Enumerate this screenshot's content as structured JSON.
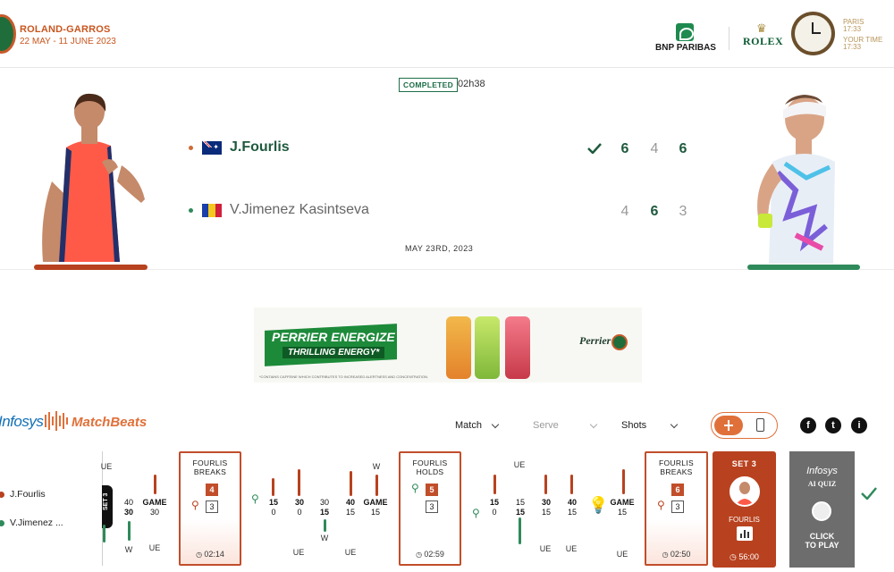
{
  "header": {
    "event_title": "ROLAND-GARROS",
    "event_dates": "22 MAY - 11 JUNE 2023",
    "sponsor_bnp": "BNP PARIBAS",
    "sponsor_rolex": "ROLEX",
    "clock_paris_label": "PARIS",
    "clock_paris_time": "17:33",
    "clock_your_label": "YOUR TIME",
    "clock_your_time": "17:33"
  },
  "match": {
    "status": "COMPLETED",
    "duration": "02h38",
    "date": "MAY 23RD, 2023",
    "player1": {
      "name": "J.Fourlis",
      "dot_color": "#d06a37",
      "winner": true,
      "sets": [
        "6",
        "4",
        "6"
      ]
    },
    "player2": {
      "name": "V.Jimenez Kasintseva",
      "dot_color": "#2f8a5b",
      "winner": false,
      "sets": [
        "4",
        "6",
        "3"
      ]
    }
  },
  "ad": {
    "headline": "PERRIER ENERGIZE",
    "subline": "THRILLING ENERGY*",
    "brand": "Perrier",
    "fineprint": "*CONTAINS CAFFEINE WHICH CONTRIBUTES TO INCREASED ALERTNESS AND CONCENTRATION."
  },
  "matchbeats": {
    "brand_a": "Infosys",
    "brand_b": "MatchBeats",
    "filters": [
      {
        "label": "Match",
        "active": true
      },
      {
        "label": "Serve",
        "active": false
      },
      {
        "label": "Shots",
        "active": true
      }
    ],
    "legend": [
      {
        "name": "J.Fourlis",
        "color": "#b8421f"
      },
      {
        "name": "V.Jimenez ...",
        "color": "#2f8a5b"
      }
    ],
    "set_tag": "SET 3",
    "cards": [
      {
        "title_1": "FOURLIS",
        "title_2": "BREAKS",
        "count": "4",
        "sub": "3",
        "time": "02:14"
      },
      {
        "title_1": "FOURLIS",
        "title_2": "HOLDS",
        "count": "5",
        "sub": "3",
        "time": "02:59"
      },
      {
        "title_1": "FOURLIS",
        "title_2": "BREAKS",
        "count": "6",
        "sub": "3",
        "time": "02:50"
      }
    ],
    "set3_card": {
      "title": "SET 3",
      "player": "FOURLIS",
      "time": "56:00"
    },
    "quiz": {
      "brand": "Infosys",
      "title": "AI QUIZ",
      "cta_1": "CLICK",
      "cta_2": "TO PLAY"
    },
    "point_labels": {
      "ue": "UE",
      "w": "W",
      "game": "GAME",
      "p40": "40",
      "p30": "30",
      "p15": "15",
      "p0": "0"
    }
  },
  "colors": {
    "accent_orange": "#c9561f",
    "green": "#1e5a3d",
    "card_red": "#b8421f"
  }
}
